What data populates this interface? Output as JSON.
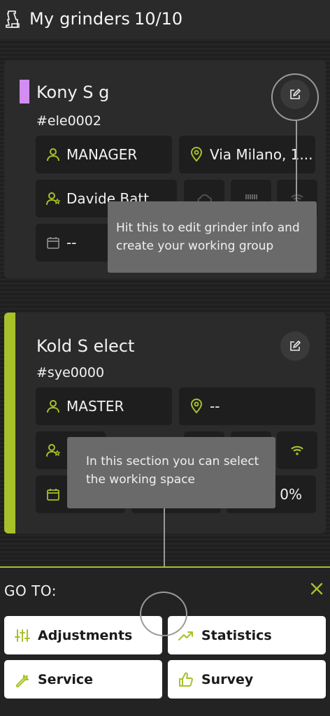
{
  "header": {
    "title": "My grinders",
    "count": "10/10"
  },
  "cards": [
    {
      "name": "Kony S g",
      "code": "#ele0002",
      "accent": "#d38df2",
      "role": "MANAGER",
      "location": "Via Milano, 1...",
      "user": "Davide Batt",
      "date": "--"
    },
    {
      "name": "Kold S elect",
      "code": "#sye0000",
      "accent": "#a6c12a",
      "role": "MASTER",
      "location": "--",
      "percent": "0%"
    }
  ],
  "tooltips": {
    "edit": "Hit this to edit grinder info and create your working group",
    "section": "In this section you can select the working space"
  },
  "goto": {
    "title": "GO TO:",
    "buttons": [
      "Adjustments",
      "Statistics",
      "Service",
      "Survey"
    ]
  },
  "colors": {
    "accent_green": "#a6c12a",
    "accent_purple": "#d38df2",
    "background": "#262626"
  },
  "icons": [
    "grinder-logo-icon",
    "edit-icon",
    "user-icon",
    "location-pin-icon",
    "user-star-icon",
    "cloud-icon",
    "barcode-icon",
    "wifi-icon",
    "calendar-icon",
    "close-icon",
    "sliders-icon",
    "trending-up-icon",
    "wrench-icon",
    "thumbs-up-icon"
  ]
}
